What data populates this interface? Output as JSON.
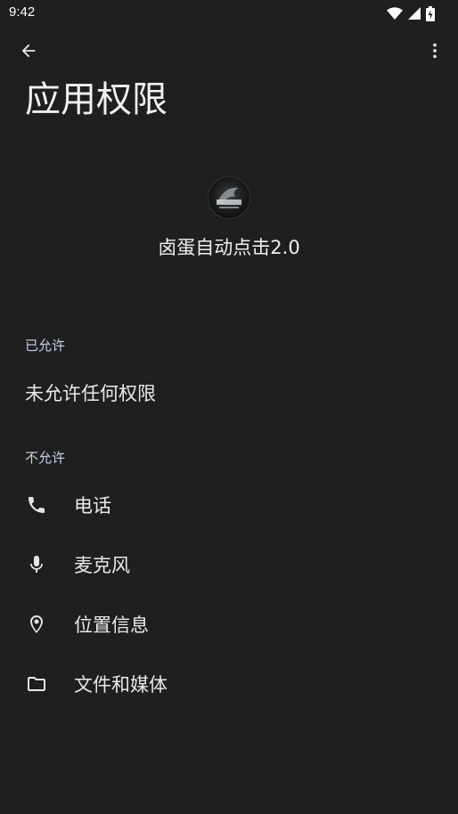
{
  "status_bar": {
    "time": "9:42",
    "icons": [
      "wifi-icon",
      "cell-signal-icon",
      "battery-icon"
    ]
  },
  "toolbar": {
    "back_icon": "arrow-back-icon",
    "more_icon": "more-vert-icon"
  },
  "page": {
    "title": "应用权限"
  },
  "app": {
    "name": "卤蛋自动点击2.0",
    "icon": "app-logo"
  },
  "sections": {
    "allowed": {
      "header": "已允许",
      "empty_text": "未允许任何权限"
    },
    "denied": {
      "header": "不允许",
      "items": [
        {
          "label": "电话",
          "icon": "phone-icon"
        },
        {
          "label": "麦克风",
          "icon": "mic-icon"
        },
        {
          "label": "位置信息",
          "icon": "location-icon"
        },
        {
          "label": "文件和媒体",
          "icon": "folder-icon"
        }
      ]
    }
  },
  "colors": {
    "background": "#1f1f1f",
    "text_primary": "#eaeaea",
    "section_header": "#c7d3ea"
  }
}
